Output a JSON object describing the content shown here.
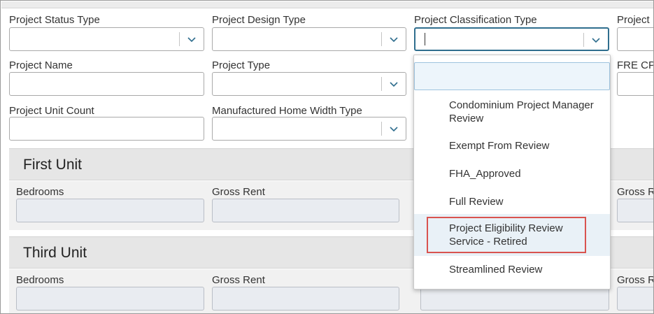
{
  "form": {
    "project_status_type_label": "Project Status Type",
    "project_design_type_label": "Project Design Type",
    "project_classification_type_label": "Project Classification Type",
    "project_col4_label": "Project",
    "project_name_label": "Project Name",
    "project_type_label": "Project Type",
    "fre_label": "FRE CP",
    "project_unit_count_label": "Project Unit Count",
    "manufactured_home_width_type_label": "Manufactured Home Width Type"
  },
  "sections": {
    "first_unit": {
      "title": "First Unit",
      "bedrooms_label": "Bedrooms",
      "gross_rent_label": "Gross Rent",
      "gross_rent_right_label": "Gross R"
    },
    "third_unit": {
      "title": "Third Unit",
      "bedrooms_label": "Bedrooms",
      "gross_rent_label": "Gross Rent",
      "gross_rent_right_label": "Gross R"
    }
  },
  "dropdown": {
    "search_value": "",
    "options": [
      "Condominium Project Manager Review",
      "Exempt From Review",
      "FHA_Approved",
      "Full Review",
      "Project Eligibility Review Service - Retired",
      "Streamlined Review"
    ],
    "highlighted_index": 4
  },
  "colors": {
    "active_border": "#2f6e8e",
    "highlight_box": "#d9534f",
    "section_bg": "#e6e6e6",
    "disabled_field": "#e9ecf1"
  }
}
